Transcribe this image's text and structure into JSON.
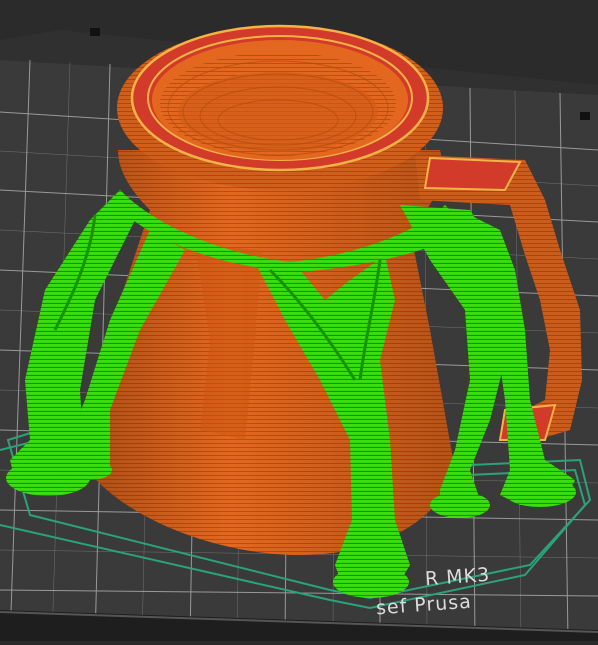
{
  "viewport": {
    "background_color": "#2b2b2b",
    "bed_color": "#3d3d3d",
    "grid_color": "#c8c8c8",
    "print_color": "#e4671f",
    "print_dark_color": "#a8430c",
    "top_surface_color": "#d23a2a",
    "support_color": "#3cdc12",
    "support_dark_color": "#1f8f08",
    "skirt_color": "#2aa37a"
  },
  "bed_labels": {
    "model": "R MK3",
    "maker": "sef Prusa"
  }
}
